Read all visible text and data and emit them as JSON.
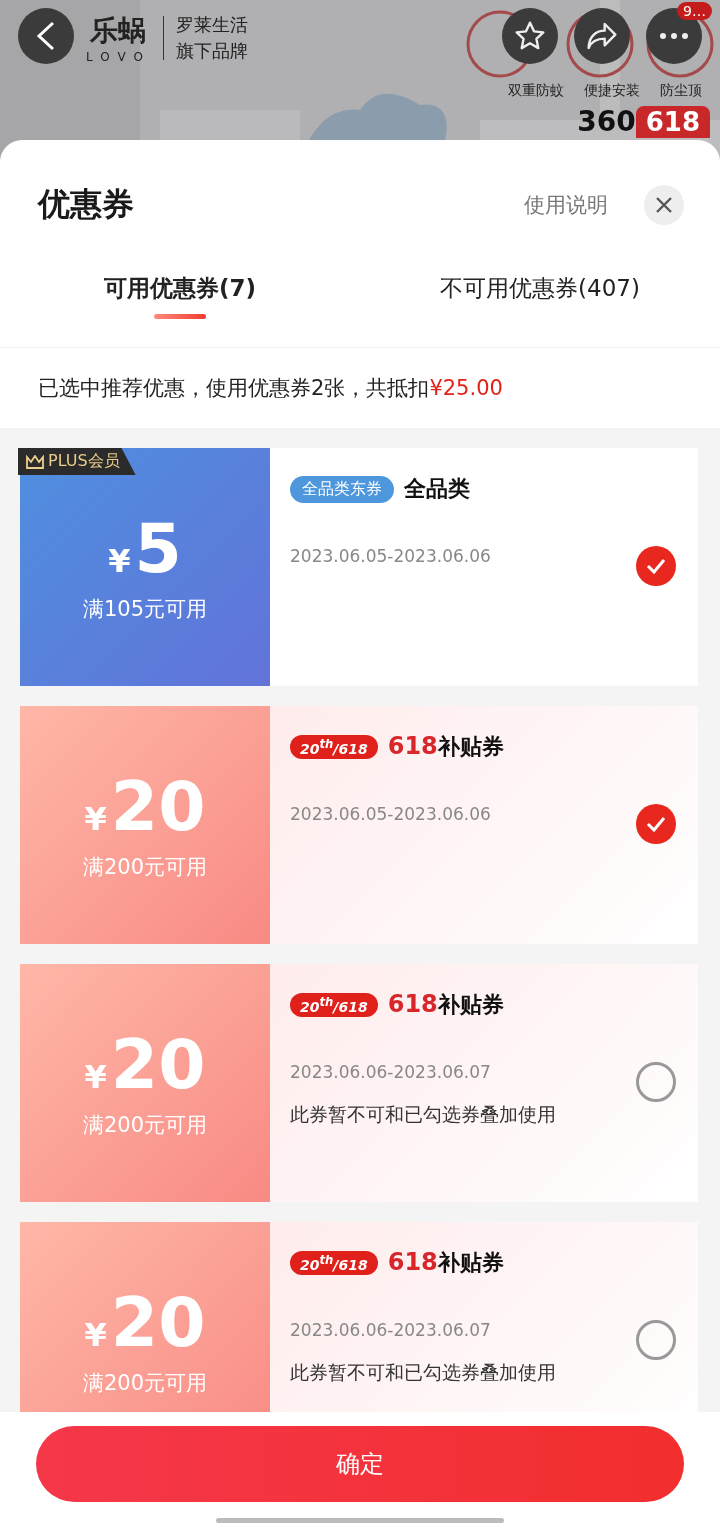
{
  "header": {
    "brand": {
      "name": "乐蜗",
      "latin": "LOVO",
      "line1": "罗莱生活",
      "line2": "旗下品牌"
    },
    "more_badge": "9…",
    "features": [
      "双重防蚊",
      "便捷安装",
      "防尘顶"
    ],
    "price": "360",
    "promo_tag": "618"
  },
  "sheet": {
    "title": "优惠券",
    "help": "使用说明",
    "tabs": [
      {
        "label": "可用优惠券(7)",
        "selected": true
      },
      {
        "label": "不可用优惠券(407)",
        "selected": false
      }
    ],
    "summary": {
      "text": "已选中推荐优惠，使用优惠券2张，共抵扣",
      "amount": "¥25.00"
    },
    "coupons": [
      {
        "kind": "plus",
        "badge": "PLUS会员",
        "currency": "¥",
        "amount": "5",
        "condition": "满105元可用",
        "tag": "全品类东券",
        "title": "全品类",
        "dates": "2023.06.05-2023.06.06",
        "selected": true
      },
      {
        "kind": "subsidy",
        "currency": "¥",
        "amount": "20",
        "condition": "满200元可用",
        "tag": "20$^{th}$/618",
        "title_highlight": "618",
        "title": "补贴券",
        "dates": "2023.06.05-2023.06.06",
        "selected": true
      },
      {
        "kind": "subsidy",
        "currency": "¥",
        "amount": "20",
        "condition": "满200元可用",
        "tag": "20$^{th}$/618",
        "title_highlight": "618",
        "title": "补贴券",
        "dates": "2023.06.06-2023.06.07",
        "note": "此券暂不可和已勾选券叠加使用",
        "selected": false
      },
      {
        "kind": "subsidy",
        "currency": "¥",
        "amount": "20",
        "condition": "满200元可用",
        "tag": "20$^{th}$/618",
        "title_highlight": "618",
        "title": "补贴券",
        "dates": "2023.06.06-2023.06.07",
        "note": "此券暂不可和已勾选券叠加使用",
        "selected": false
      }
    ],
    "confirm": "确定"
  }
}
